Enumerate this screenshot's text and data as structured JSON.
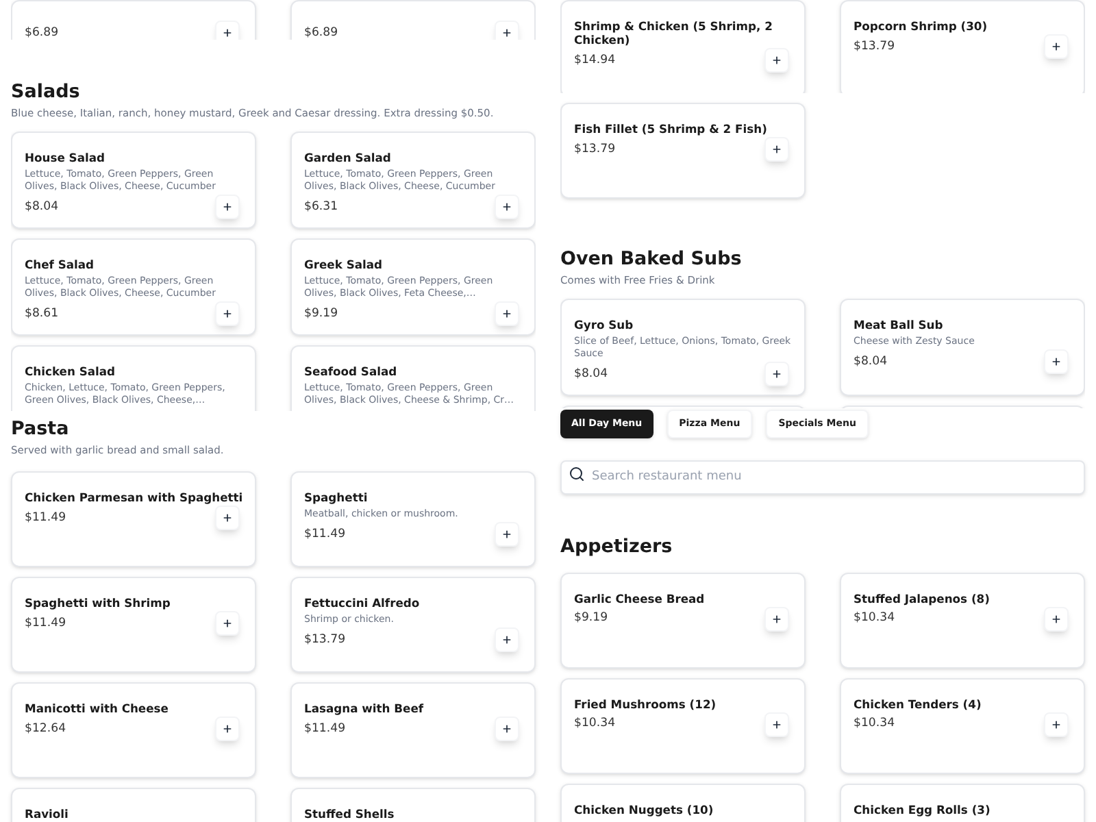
{
  "left": {
    "partial_items": [
      {
        "price": "$6.89"
      },
      {
        "price": "$6.89"
      }
    ],
    "sections": [
      {
        "title": "Salads",
        "description": "Blue cheese, Italian, ranch, honey mustard, Greek and Caesar dressing. Extra dressing $0.50.",
        "items": [
          {
            "name": "House Salad",
            "description": "Lettuce, Tomato, Green Peppers, Green Olives, Black Olives, Cheese, Cucumber",
            "price": "$8.04"
          },
          {
            "name": "Garden Salad",
            "description": "Lettuce, Tomato, Green Peppers, Green Olives, Black Olives, Cheese, Cucumber",
            "price": "$6.31"
          },
          {
            "name": "Chef Salad",
            "description": "Lettuce, Tomato, Green Peppers, Green Olives, Black Olives, Cheese, Cucumber",
            "price": "$8.61"
          },
          {
            "name": "Greek Salad",
            "description": "Lettuce, Tomato, Green Peppers, Green Olives, Black Olives, Feta Cheese,…",
            "price": "$9.19"
          },
          {
            "name": "Chicken Salad",
            "description": "Chicken, Lettuce, Tomato, Green Peppers, Green Olives, Black Olives, Cheese,…"
          },
          {
            "name": "Seafood Salad",
            "description": "Lettuce, Tomato, Green Peppers, Green Olives, Black Olives, Cheese & Shrimp, Cr…"
          }
        ]
      },
      {
        "title": "Pasta",
        "description": "Served with garlic bread and small salad.",
        "items": [
          {
            "name": "Chicken Parmesan with Spaghetti",
            "price": "$11.49"
          },
          {
            "name": "Spaghetti",
            "description": "Meatball, chicken or mushroom.",
            "price": "$11.49"
          },
          {
            "name": "Spaghetti with Shrimp",
            "price": "$11.49"
          },
          {
            "name": "Fettuccini Alfredo",
            "description": "Shrimp or chicken.",
            "price": "$13.79"
          },
          {
            "name": "Manicotti with Cheese",
            "price": "$12.64"
          },
          {
            "name": "Lasagna with Beef",
            "price": "$11.49"
          },
          {
            "name": "Ravioli"
          },
          {
            "name": "Stuffed Shells"
          }
        ]
      }
    ]
  },
  "right": {
    "partial_items": [
      {
        "name": "Shrimp & Chicken (5 Shrimp, 2 Chicken)",
        "price": "$14.94"
      },
      {
        "name": "Popcorn Shrimp (30)",
        "price": "$13.79"
      },
      {
        "name": "Fish Fillet (5 Shrimp & 2 Fish)",
        "price": "$13.79"
      }
    ],
    "subs": {
      "title": "Oven Baked Subs",
      "description": "Comes with Free Fries & Drink",
      "items": [
        {
          "name": "Gyro Sub",
          "description": "Slice of Beef, Lettuce, Onions, Tomato, Greek Sauce",
          "price": "$8.04"
        },
        {
          "name": "Meat Ball Sub",
          "description": "Cheese with Zesty Sauce",
          "price": "$8.04"
        }
      ]
    },
    "tabs": [
      {
        "label": "All Day Menu",
        "selected": true
      },
      {
        "label": "Pizza Menu",
        "selected": false
      },
      {
        "label": "Specials Menu",
        "selected": false
      }
    ],
    "search": {
      "placeholder": "Search restaurant menu"
    },
    "appetizers": {
      "title": "Appetizers",
      "items": [
        {
          "name": "Garlic Cheese Bread",
          "price": "$9.19"
        },
        {
          "name": "Stuffed Jalapenos (8)",
          "price": "$10.34"
        },
        {
          "name": "Fried Mushrooms (12)",
          "price": "$10.34"
        },
        {
          "name": "Chicken Tenders (4)",
          "price": "$10.34"
        },
        {
          "name": "Chicken Nuggets (10)"
        },
        {
          "name": "Chicken Egg Rolls (3)"
        }
      ]
    }
  }
}
